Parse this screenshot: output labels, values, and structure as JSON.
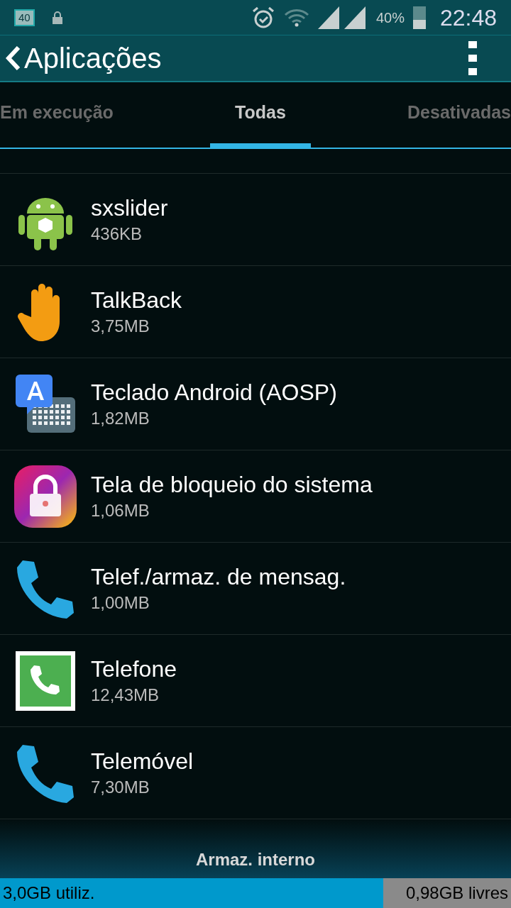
{
  "status_bar": {
    "badge": "40",
    "battery_percent": "40%",
    "time": "22:48"
  },
  "app_bar": {
    "title": "Aplicações"
  },
  "tabs": [
    {
      "label": "Em execução",
      "selected": false
    },
    {
      "label": "Todas",
      "selected": true
    },
    {
      "label": "Desativadas",
      "selected": false
    }
  ],
  "apps": [
    {
      "name": "sxslider",
      "size": "436KB",
      "kind": "android"
    },
    {
      "name": "TalkBack",
      "size": "3,75MB",
      "kind": "hand"
    },
    {
      "name": "Teclado Android (AOSP)",
      "size": "1,82MB",
      "kind": "keyboard"
    },
    {
      "name": "Tela de bloqueio do sistema",
      "size": "1,06MB",
      "kind": "lock"
    },
    {
      "name": "Telef./armaz. de mensag.",
      "size": "1,00MB",
      "kind": "phone"
    },
    {
      "name": "Telefone",
      "size": "12,43MB",
      "kind": "dialer"
    },
    {
      "name": "Telemóvel",
      "size": "7,30MB",
      "kind": "phone"
    }
  ],
  "storage": {
    "title": "Armaz. interno",
    "used": "3,0GB utiliz.",
    "free": "0,98GB livres",
    "level": 0.75
  }
}
